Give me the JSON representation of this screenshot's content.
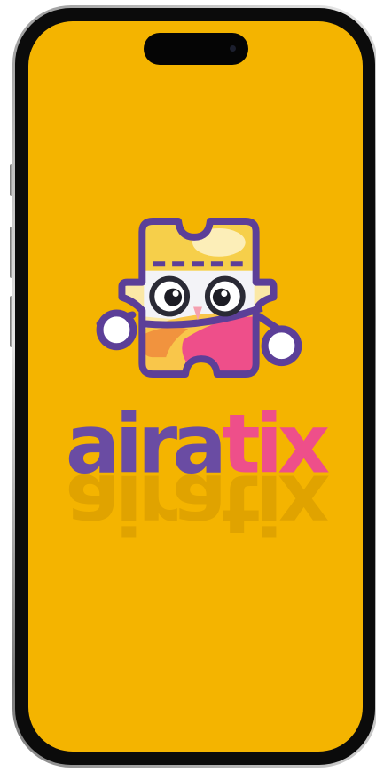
{
  "app": {
    "brand_part1": "aira",
    "brand_part2": "tix",
    "screen": "splash"
  },
  "colors": {
    "background": "#f4b400",
    "brand_purple": "#6a4ca3",
    "brand_pink": "#ee4f8a",
    "mascot_outline": "#5c3f98",
    "mascot_cream": "#fbe8a6"
  },
  "icons": {
    "mascot": "ticket-mascot-icon"
  }
}
